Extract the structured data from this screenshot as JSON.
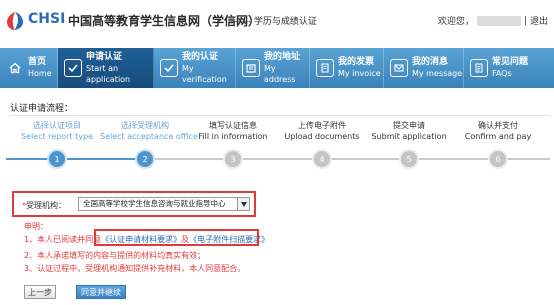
{
  "header": {
    "logo_text": "CHSI",
    "site_title": "中国高等教育学生信息网（学信网）",
    "site_subtitle": "—— 学历与成绩认证",
    "welcome_prefix": "欢迎您，",
    "logout_label": "退出",
    "colors": {
      "brand": "#2b6db5"
    }
  },
  "nav": {
    "items": [
      {
        "zh": "首页",
        "en": "Home",
        "icon": "home-icon",
        "active": false
      },
      {
        "zh": "申请认证",
        "en": "Start an application",
        "icon": "checkbox-icon",
        "active": true
      },
      {
        "zh": "我的认证",
        "en": "My verification",
        "icon": "checkbox-icon",
        "active": false
      },
      {
        "zh": "我的地址",
        "en": "My address",
        "icon": "address-icon",
        "active": false
      },
      {
        "zh": "我的发票",
        "en": "My invoice",
        "icon": "invoice-icon",
        "active": false
      },
      {
        "zh": "我的消息",
        "en": "My message",
        "icon": "message-icon",
        "active": false
      },
      {
        "zh": "常见问题",
        "en": "FAQs",
        "icon": "faq-icon",
        "active": false
      }
    ],
    "colors": {
      "bar": "#4a93c8",
      "active": "#1c5789"
    }
  },
  "flow": {
    "title": "认证申请流程：",
    "steps": [
      {
        "zh": "选择认证项目",
        "en": "Select report type",
        "number": "1",
        "state": "done"
      },
      {
        "zh": "选择受理机构",
        "en": "Select acceptance office",
        "number": "2",
        "state": "done"
      },
      {
        "zh": "填写认证信息",
        "en": "Fill in information",
        "number": "3",
        "state": "todo"
      },
      {
        "zh": "上传电子附件",
        "en": "Upload documents",
        "number": "4",
        "state": "todo"
      },
      {
        "zh": "提交申请",
        "en": "Submit application",
        "number": "5",
        "state": "todo"
      },
      {
        "zh": "确认并支付",
        "en": "Confirm and pay",
        "number": "6",
        "state": "todo"
      }
    ]
  },
  "form": {
    "required_mark": "*",
    "office_label": "受理机构：",
    "office_selected": "全国高等学校学生信息咨询与就业指导中心"
  },
  "declaration": {
    "title": "申明：",
    "line1_prefix": "1、本人已阅读并同意",
    "link1": "《认证申请材料要求》",
    "line1_joiner": "及",
    "link2": "《电子附件扫描要求》",
    "line2": "2、本人承诺填写的内容与提供的材料均真实有效；",
    "line3": "3、认证过程中，受理机构通知提供补充材料，本人同意配合。"
  },
  "buttons": {
    "prev": "上一步",
    "next": "同意并继续"
  }
}
